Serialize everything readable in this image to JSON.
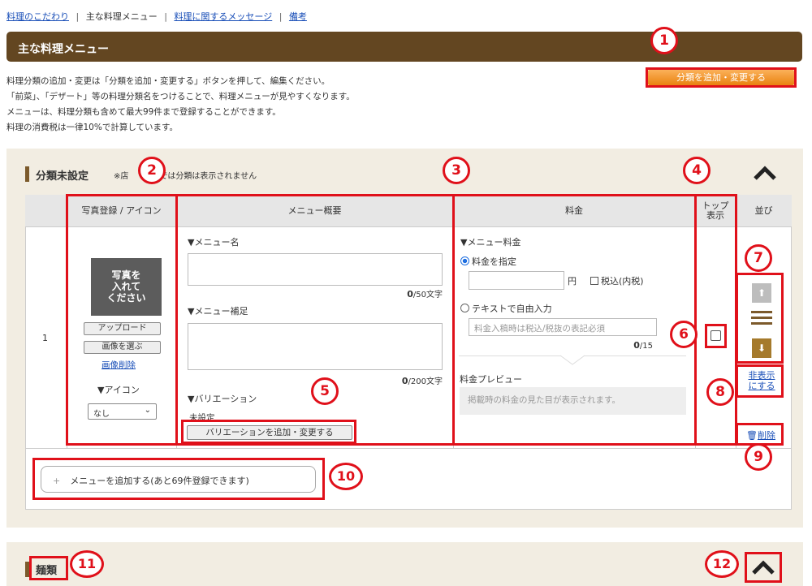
{
  "tabs": {
    "items": [
      "料理のこだわり",
      "主な料理メニュー",
      "料理に関するメッセージ",
      "備考"
    ],
    "separator": "|"
  },
  "header": {
    "title": "主な料理メニュー"
  },
  "add_category_button": {
    "label": "分類を追加・変更する"
  },
  "description": [
    "料理分類の追加・変更は「分類を追加・変更する」ボタンを押して、編集ください。",
    "「前菜」、「デザート」等の料理分類名をつけることで、料理メニューが見やすくなります。",
    "メニューは、料理分類も含めて最大99件まで登録することができます。",
    "料理の消費税は一律10%で計算しています。"
  ],
  "category1": {
    "title": "分類未設定",
    "note_prefix": "※店",
    "note_suffix": "では分類は表示されません",
    "collapse_icon": "chevron-up-icon"
  },
  "table": {
    "headers": {
      "photo": "写真登録 / アイコン",
      "overview": "メニュー概要",
      "price": "料金",
      "top_display": "トップ\n表示",
      "order": "並び"
    }
  },
  "row": {
    "index": "1",
    "photo_placeholder": "写真を\n入れて\nください",
    "upload_button": "アップロード",
    "choose_image_button": "画像を選ぶ",
    "delete_image_link": "画像削除",
    "icon_label": "▼アイコン",
    "icon_select_value": "なし",
    "menu_name_label": "▼メニュー名",
    "menu_name_count": "0",
    "menu_name_max": "/50文字",
    "menu_note_label": "▼メニュー補足",
    "menu_note_count": "0",
    "menu_note_max": "/200文字",
    "variation_label": "▼バリエーション",
    "variation_value": "未設定",
    "variation_button": "バリエーションを追加・変更する",
    "price_label": "▼メニュー料金",
    "price_fixed_label": "料金を指定",
    "yen": "円",
    "tax_included_label": "税込(内税)",
    "free_text_label": "テキストで自由入力",
    "free_text_placeholder": "料金入稿時は税込/税抜の表記必須",
    "free_text_count": "0",
    "free_text_max": "/15",
    "preview_label": "料金プレビュー",
    "preview_text": "掲載時の料金の見た目が表示されます。",
    "hide_link": "非表示\nにする",
    "delete_link": "削除"
  },
  "add_menu_button": {
    "plus": "+",
    "label": "メニューを追加する(あと69件登録できます)"
  },
  "category2": {
    "title": "麺類",
    "collapse_icon": "chevron-up-icon"
  },
  "annotations": [
    "1",
    "2",
    "3",
    "4",
    "5",
    "6",
    "7",
    "8",
    "9",
    "10",
    "11",
    "12"
  ],
  "colors": {
    "title_bar": "#634621",
    "annotation_red": "#e0101a",
    "orange_button": "#e98210",
    "link_blue": "#1a4fb8",
    "section_bg": "#f2ede2",
    "arrow_gold": "#a57a2c",
    "arrow_grey": "#bdbdbd"
  }
}
